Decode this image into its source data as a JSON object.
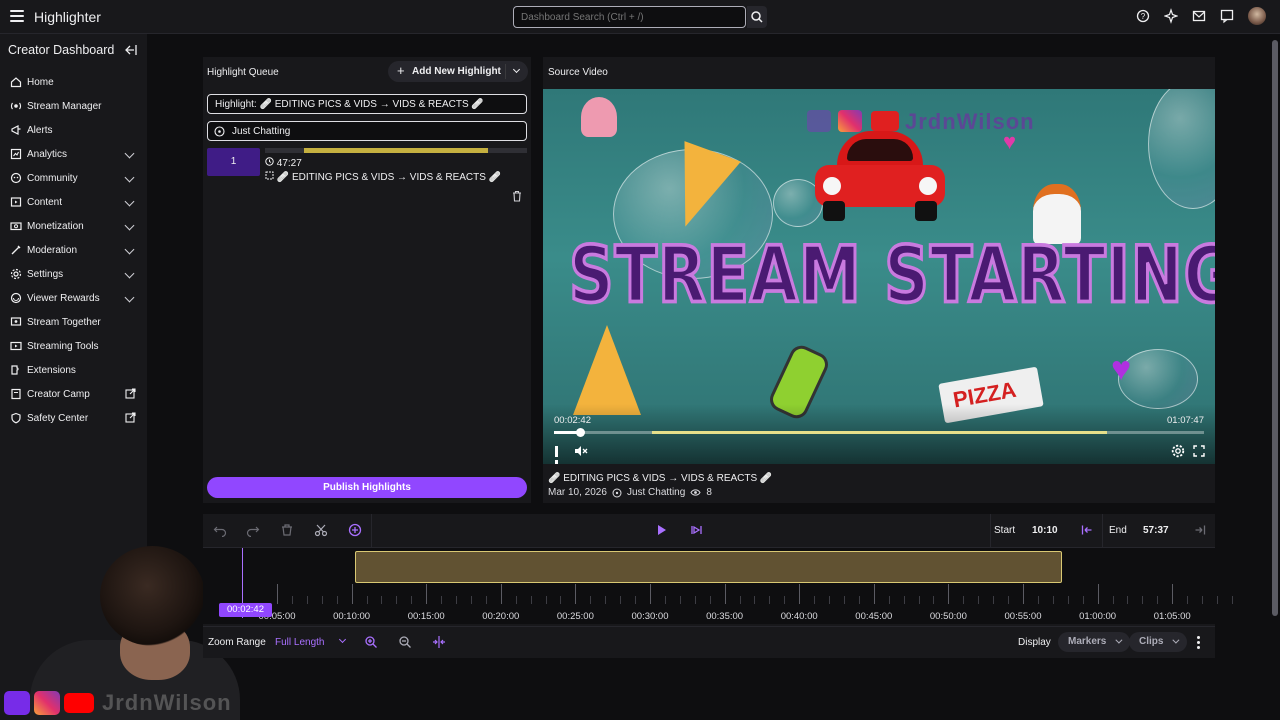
{
  "app": {
    "title": "Highlighter"
  },
  "search": {
    "placeholder": "Dashboard Search (Ctrl + /)"
  },
  "top_icons": [
    "help-icon",
    "extensions-icon",
    "inbox-icon",
    "whispers-icon"
  ],
  "sidebar": {
    "title": "Creator Dashboard",
    "items": [
      {
        "label": "Home",
        "icon": "home-icon",
        "expandable": false
      },
      {
        "label": "Stream Manager",
        "icon": "stream-manager-icon",
        "expandable": false
      },
      {
        "label": "Alerts",
        "icon": "alerts-icon",
        "expandable": false
      },
      {
        "label": "Analytics",
        "icon": "analytics-icon",
        "expandable": true
      },
      {
        "label": "Community",
        "icon": "community-icon",
        "expandable": true
      },
      {
        "label": "Content",
        "icon": "content-icon",
        "expandable": true
      },
      {
        "label": "Monetization",
        "icon": "monetization-icon",
        "expandable": true
      },
      {
        "label": "Moderation",
        "icon": "moderation-icon",
        "expandable": true
      },
      {
        "label": "Settings",
        "icon": "settings-icon",
        "expandable": true
      },
      {
        "label": "Viewer Rewards",
        "icon": "viewer-rewards-icon",
        "expandable": true
      },
      {
        "label": "Stream Together",
        "icon": "stream-together-icon",
        "expandable": false
      },
      {
        "label": "Streaming Tools",
        "icon": "streaming-tools-icon",
        "expandable": false
      },
      {
        "label": "Extensions",
        "icon": "extensions-icon",
        "expandable": false
      },
      {
        "label": "Creator Camp",
        "icon": "creator-camp-icon",
        "external": true
      },
      {
        "label": "Safety Center",
        "icon": "safety-center-icon",
        "external": true
      }
    ]
  },
  "queue": {
    "title": "Highlight Queue",
    "add_label": "Add New Highlight",
    "title_field": "Highlight: 🩹 EDITING PICS & VIDS → VIDS & REACTS 🩹",
    "category_field": "Just Chatting",
    "item": {
      "index": "1",
      "duration": "47:27",
      "progress_start": 0.15,
      "progress_end": 0.85,
      "title": "🩹 EDITING PICS & VIDS → VIDS & REACTS 🩹"
    },
    "publish_label": "Publish Highlights"
  },
  "source": {
    "title": "Source Video",
    "overlay_text": "STREAM STARTING SOON",
    "brand_text": "JrdnWilson",
    "box_text": "PIZZA",
    "current_time": "00:02:42",
    "total_time": "01:07:47",
    "played_fraction": 0.04,
    "range_start": 0.15,
    "range_end": 0.85,
    "video_title": "🩹 EDITING PICS & VIDS → VIDS & REACTS 🩹",
    "date": "Mar 10, 2026",
    "category": "Just Chatting",
    "views": "8"
  },
  "timeline": {
    "start_label": "Start",
    "start_value": "10:10",
    "end_label": "End",
    "end_value": "57:37",
    "playhead_label": "00:02:42",
    "ticks": [
      "00:05:00",
      "00:10:00",
      "00:15:00",
      "00:20:00",
      "00:25:00",
      "00:30:00",
      "00:35:00",
      "00:40:00",
      "00:45:00",
      "00:50:00",
      "00:55:00",
      "01:00:00",
      "01:05:00"
    ],
    "zoom_label": "Zoom Range",
    "zoom_value": "Full Length",
    "display_label": "Display",
    "markers_label": "Markers",
    "clips_label": "Clips"
  },
  "colors": {
    "accent": "#9147ff",
    "clip_border": "#d9c873",
    "background": "#0e0e10",
    "panel": "#18181b"
  },
  "webcam_overlay": {
    "channel_name": "JrdnWilson"
  }
}
